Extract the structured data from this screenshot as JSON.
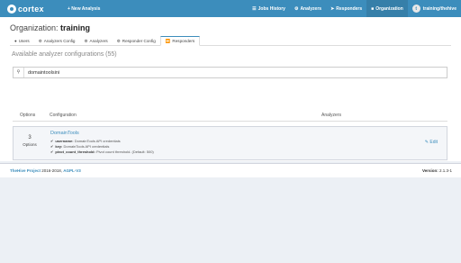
{
  "navbar": {
    "brand": "cortex",
    "new_analysis": "+ New Analysis",
    "items": [
      {
        "icon": "history-icon",
        "label": "Jobs History"
      },
      {
        "icon": "analyzers-icon",
        "label": "Analyzers"
      },
      {
        "icon": "responders-icon",
        "label": "Responders"
      },
      {
        "icon": "organization-icon",
        "label": "Organization"
      }
    ],
    "user_initial": "t",
    "user": "training/thehive"
  },
  "page": {
    "org_prefix": "Organization:",
    "org_name": "training",
    "tabs": [
      {
        "label": "Users",
        "active": false
      },
      {
        "label": "Analyzers Config",
        "active": false
      },
      {
        "label": "Analyzers",
        "active": false
      },
      {
        "label": "Responder Config",
        "active": false
      },
      {
        "label": "Responders",
        "active": true
      }
    ],
    "section_title": "Available analyzer configurations (55)",
    "search_value": "domaintoolsini",
    "table": {
      "headers": [
        "Options",
        "Configuration",
        "Analyzers"
      ],
      "row": {
        "options_count": "3",
        "options_label": "Options",
        "name": "DomainTools",
        "configs": [
          {
            "key": "username:",
            "desc": "DomainTools API credentials"
          },
          {
            "key": "key:",
            "desc": "DomainTools API credentials"
          },
          {
            "key": "pivot_count_threshold:",
            "desc": "Pivot count threshold. (Default: 500)"
          }
        ],
        "edit_label": "Edit"
      }
    }
  },
  "footer": {
    "project": "TheHive Project",
    "years": " 2016-2018, ",
    "license": "AGPL-V3",
    "version_label": "Version:",
    "version": " 2.1.3-1"
  }
}
